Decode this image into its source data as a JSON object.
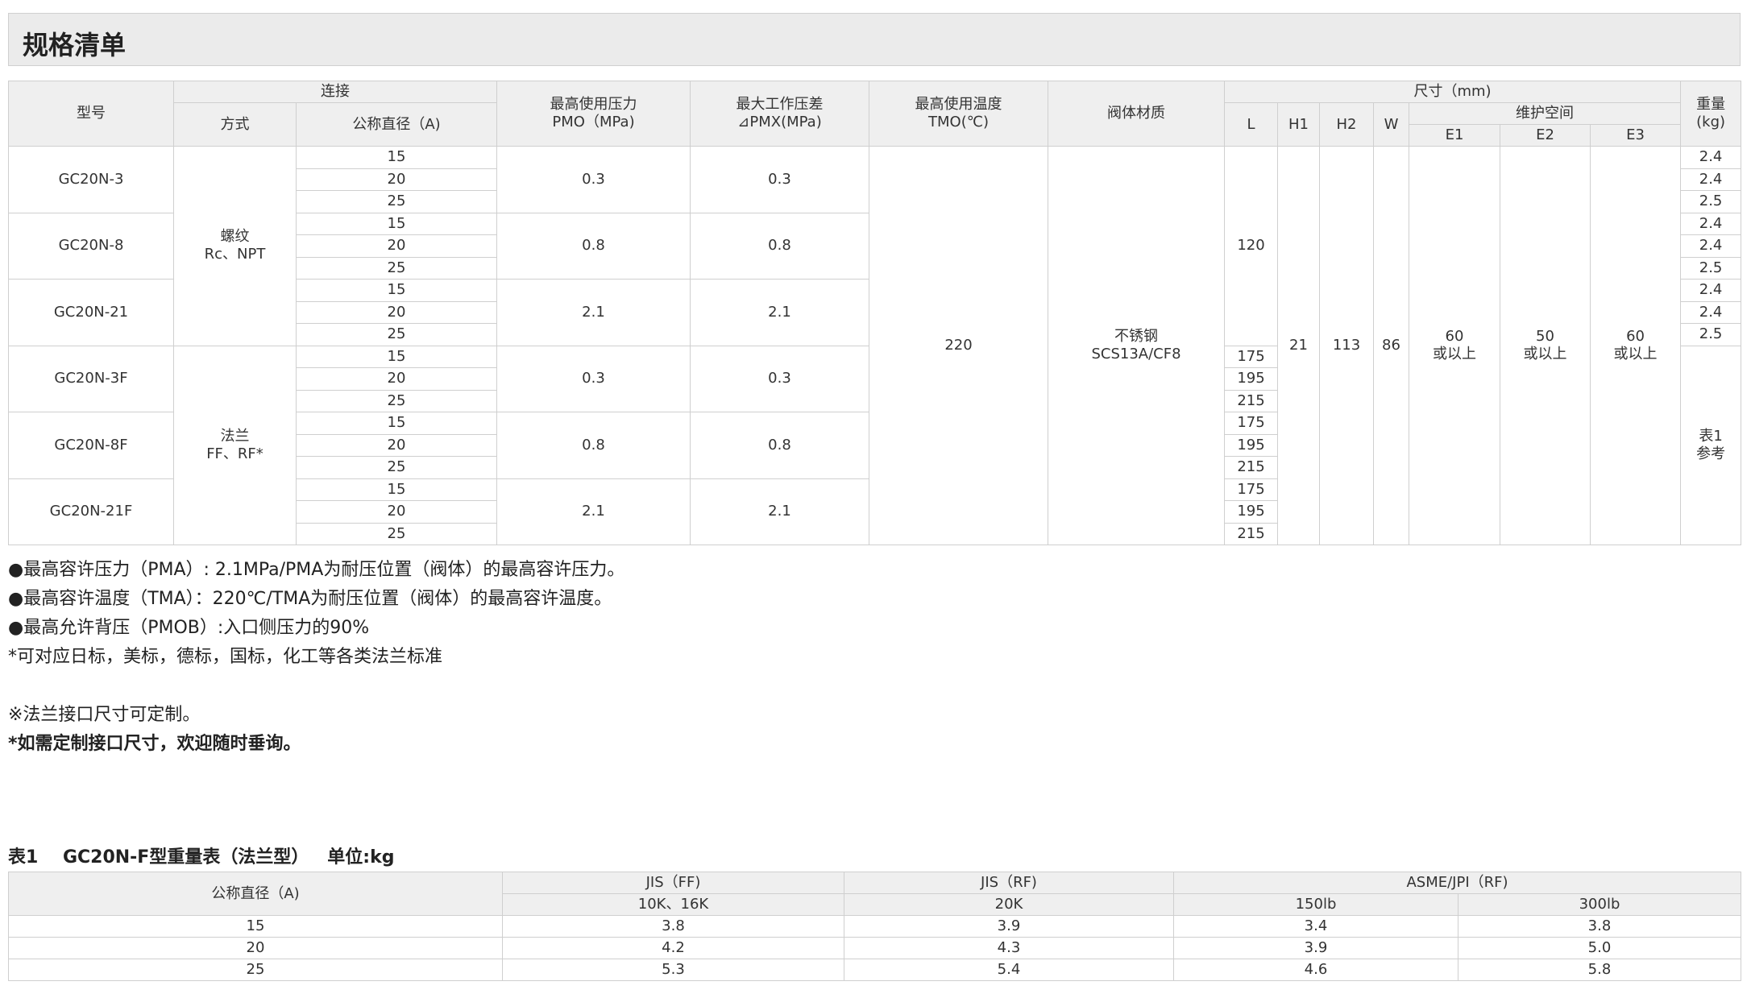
{
  "page_title": "规格清单",
  "spec_table": {
    "headers": {
      "model": "型号",
      "connection": "连接",
      "method": "方式",
      "nominal_diameter": "公称直径（A)",
      "max_pressure_l1": "最高使用压力",
      "max_pressure_l2": "PMO（MPa)",
      "max_diff_l1": "最大工作压差",
      "max_diff_l2": "⊿PMX(MPa)",
      "max_temp_l1": "最高使用温度",
      "max_temp_l2": "TMO(℃)",
      "body_material": "阀体材质",
      "dimensions": "尺寸（mm)",
      "L": "L",
      "H1": "H1",
      "H2": "H2",
      "W": "W",
      "maintenance_space": "维护空间",
      "E1": "E1",
      "E2": "E2",
      "E3": "E3",
      "weight_l1": "重量",
      "weight_l2": "(kg)"
    },
    "groups": [
      {
        "model": "GC20N-3",
        "pmo": "0.3",
        "pmx": "0.3",
        "diameters": [
          "15",
          "20",
          "25"
        ],
        "weights": [
          "2.4",
          "2.4",
          "2.5"
        ]
      },
      {
        "model": "GC20N-8",
        "pmo": "0.8",
        "pmx": "0.8",
        "diameters": [
          "15",
          "20",
          "25"
        ],
        "weights": [
          "2.4",
          "2.4",
          "2.5"
        ]
      },
      {
        "model": "GC20N-21",
        "pmo": "2.1",
        "pmx": "2.1",
        "diameters": [
          "15",
          "20",
          "25"
        ],
        "weights": [
          "2.4",
          "2.4",
          "2.5"
        ]
      },
      {
        "model": "GC20N-3F",
        "pmo": "0.3",
        "pmx": "0.3",
        "diameters": [
          "15",
          "20",
          "25"
        ],
        "L": [
          "175",
          "195",
          "215"
        ]
      },
      {
        "model": "GC20N-8F",
        "pmo": "0.8",
        "pmx": "0.8",
        "diameters": [
          "15",
          "20",
          "25"
        ],
        "L": [
          "175",
          "195",
          "215"
        ]
      },
      {
        "model": "GC20N-21F",
        "pmo": "2.1",
        "pmx": "2.1",
        "diameters": [
          "15",
          "20",
          "25"
        ],
        "L": [
          "175",
          "195",
          "215"
        ]
      }
    ],
    "thread_method_l1": "螺纹",
    "thread_method_l2": "Rc、NPT",
    "flange_method_l1": "法兰",
    "flange_method_l2": "FF、RF*",
    "tmo": "220",
    "material_l1": "不锈钢",
    "material_l2": "SCS13A/CF8",
    "L_thread": "120",
    "H1": "21",
    "H2": "113",
    "W": "86",
    "E1_l1": "60",
    "E1_l2": "或以上",
    "E2_l1": "50",
    "E2_l2": "或以上",
    "E3_l1": "60",
    "E3_l2": "或以上",
    "flange_weight_ref_l1": "表1",
    "flange_weight_ref_l2": "参考"
  },
  "notes": {
    "pma": "●最高容许压力（PMA）: 2.1MPa/PMA为耐压位置（阀体）的最高容许压力。",
    "tma": "●最高容许温度（TMA）：220℃/TMA为耐压位置（阀体）的最高容许温度。",
    "pmob": "●最高允许背压（PMOB）:入口侧压力的90%",
    "flange_standards": "*可对应日标，美标，德标，国标，化工等各类法兰标准",
    "custom_flange": "※法兰接口尺寸可定制。",
    "inquiry": "*如需定制接口尺寸，欢迎随时垂询。"
  },
  "weight_table": {
    "caption": "表1    GC20N-F型重量表（法兰型）   单位:kg",
    "headers": {
      "nominal_diameter": "公称直径（A)",
      "jis_ff": "JIS（FF)",
      "jis_ff_sub": "10K、16K",
      "jis_rf": "JIS（RF)",
      "jis_rf_sub": "20K",
      "asme": "ASME/JPI（RF)",
      "asme_150": "150lb",
      "asme_300": "300lb"
    },
    "rows": [
      {
        "dn": "15",
        "jis_ff": "3.8",
        "jis_rf": "3.9",
        "asme_150": "3.4",
        "asme_300": "3.8"
      },
      {
        "dn": "20",
        "jis_ff": "4.2",
        "jis_rf": "4.3",
        "asme_150": "3.9",
        "asme_300": "5.0"
      },
      {
        "dn": "25",
        "jis_ff": "5.3",
        "jis_rf": "5.4",
        "asme_150": "4.6",
        "asme_300": "5.8"
      }
    ]
  }
}
